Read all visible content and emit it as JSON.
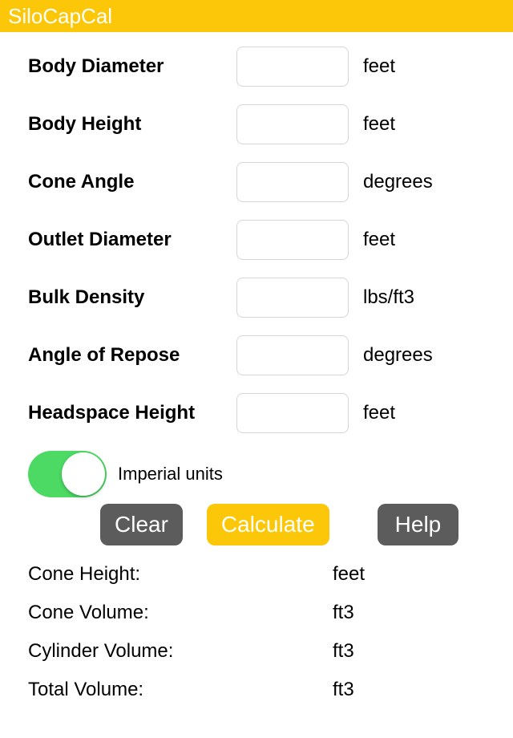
{
  "header": {
    "title": "SiloCapCal"
  },
  "inputs": [
    {
      "name": "body-diameter",
      "label": "Body Diameter",
      "value": "",
      "unit": "feet"
    },
    {
      "name": "body-height",
      "label": "Body Height",
      "value": "",
      "unit": "feet"
    },
    {
      "name": "cone-angle",
      "label": "Cone Angle",
      "value": "",
      "unit": "degrees"
    },
    {
      "name": "outlet-diameter",
      "label": "Outlet Diameter",
      "value": "",
      "unit": "feet"
    },
    {
      "name": "bulk-density",
      "label": "Bulk Density",
      "value": "",
      "unit": "lbs/ft3"
    },
    {
      "name": "angle-of-repose",
      "label": "Angle of Repose",
      "value": "",
      "unit": "degrees"
    },
    {
      "name": "headspace-height",
      "label": "Headspace Height",
      "value": "",
      "unit": "feet"
    }
  ],
  "toggle": {
    "label": "Imperial units",
    "enabled": true
  },
  "buttons": {
    "clear": "Clear",
    "calculate": "Calculate",
    "help": "Help"
  },
  "outputs": [
    {
      "name": "cone-height",
      "label": "Cone Height:",
      "value": "",
      "unit": "feet"
    },
    {
      "name": "cone-volume",
      "label": "Cone Volume:",
      "value": "",
      "unit": "ft3"
    },
    {
      "name": "cylinder-volume",
      "label": "Cylinder Volume:",
      "value": "",
      "unit": "ft3"
    },
    {
      "name": "total-volume",
      "label": "Total Volume:",
      "value": "",
      "unit": "ft3"
    }
  ]
}
